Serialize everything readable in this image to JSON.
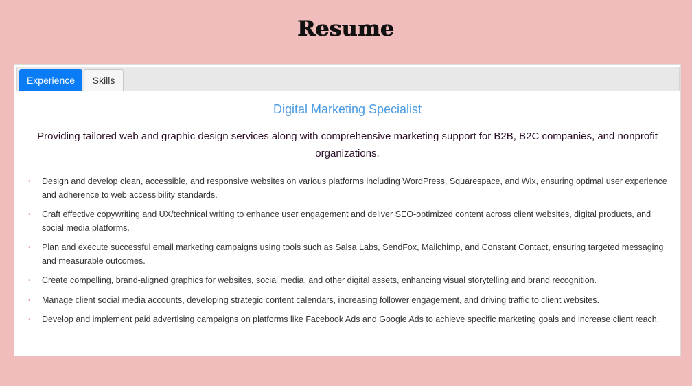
{
  "page": {
    "title": "Resume"
  },
  "tabs": [
    {
      "label": "Experience",
      "active": true
    },
    {
      "label": "Skills",
      "active": false
    }
  ],
  "experience": {
    "title": "Digital Marketing Specialist",
    "summary": "Providing tailored web and graphic design services along with comprehensive marketing support for B2B, B2C companies, and nonprofit organizations.",
    "bullet_glyph": "•",
    "duties": [
      "Design and develop clean, accessible, and responsive websites on various platforms including WordPress, Squarespace, and Wix, ensuring optimal user experience and adherence to web accessibility standards.",
      "Craft effective copywriting and UX/technical writing to enhance user engagement and deliver SEO-optimized content across client websites, digital products, and social media platforms.",
      "Plan and execute successful email marketing campaigns using tools such as Salsa Labs, SendFox, Mailchimp, and Constant Contact, ensuring targeted messaging and measurable outcomes.",
      "Create compelling, brand-aligned graphics for websites, social media, and other digital assets, enhancing visual storytelling and brand recognition.",
      "Manage client social media accounts, developing strategic content calendars, increasing follower engagement, and driving traffic to client websites.",
      "Develop and implement paid advertising campaigns on platforms like Facebook Ads and Google Ads to achieve specific marketing goals and increase client reach."
    ]
  },
  "colors": {
    "background": "#f1bcbc",
    "active_tab": "#0a7cf5",
    "job_title": "#4a9be3",
    "bullet": "#e8a1a1"
  }
}
